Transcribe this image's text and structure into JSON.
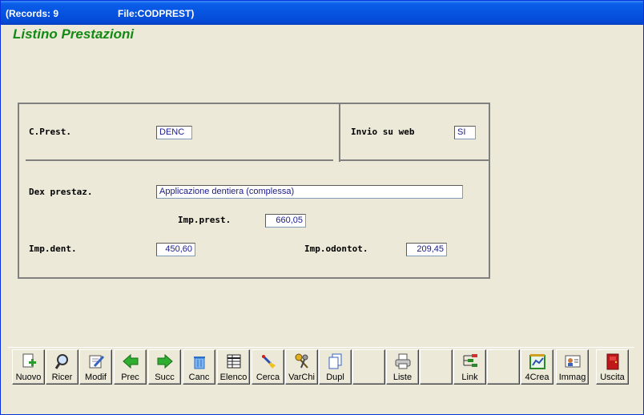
{
  "window": {
    "records": "(Records: 9",
    "file": "File:CODPREST)"
  },
  "page": {
    "title": "Listino Prestazioni"
  },
  "form": {
    "cprest_label": "C.Prest.",
    "cprest_value": "DENC",
    "invio_label": "Invio su web",
    "invio_value": "SI",
    "dex_label": "Dex prestaz.",
    "dex_value": "Applicazione dentiera (complessa)",
    "impprest_label": "Imp.prest.",
    "impprest_value": "660,05",
    "impdent_label": "Imp.dent.",
    "impdent_value": "450,60",
    "impodont_label": "Imp.odontot.",
    "impodont_value": "209,45"
  },
  "toolbar": {
    "nuovo": "Nuovo",
    "ricer": "Ricer",
    "modif": "Modif",
    "prec": "Prec",
    "succ": "Succ",
    "canc": "Canc",
    "elenco": "Elenco",
    "cerca": "Cerca",
    "varchi": "VarChi",
    "dupl": "Dupl",
    "liste": "Liste",
    "link": "Link",
    "crea4": "4Crea",
    "immag": "Immag",
    "uscita": "Uscita"
  },
  "icons": {
    "nuovo": "new-document-icon",
    "ricer": "magnifier-icon",
    "modif": "edit-document-icon",
    "prec": "arrow-left-icon",
    "succ": "arrow-right-icon",
    "canc": "trash-icon",
    "elenco": "table-list-icon",
    "cerca": "search-brush-icon",
    "varchi": "keys-icon",
    "dupl": "duplicate-icon",
    "liste": "printer-icon",
    "link": "tree-link-icon",
    "crea4": "chart-create-icon",
    "immag": "image-card-icon",
    "uscita": "exit-door-icon"
  },
  "colors": {
    "title_green": "#138a13",
    "field_text": "#1a1a8c",
    "titlebar_blue": "#0654e0"
  }
}
